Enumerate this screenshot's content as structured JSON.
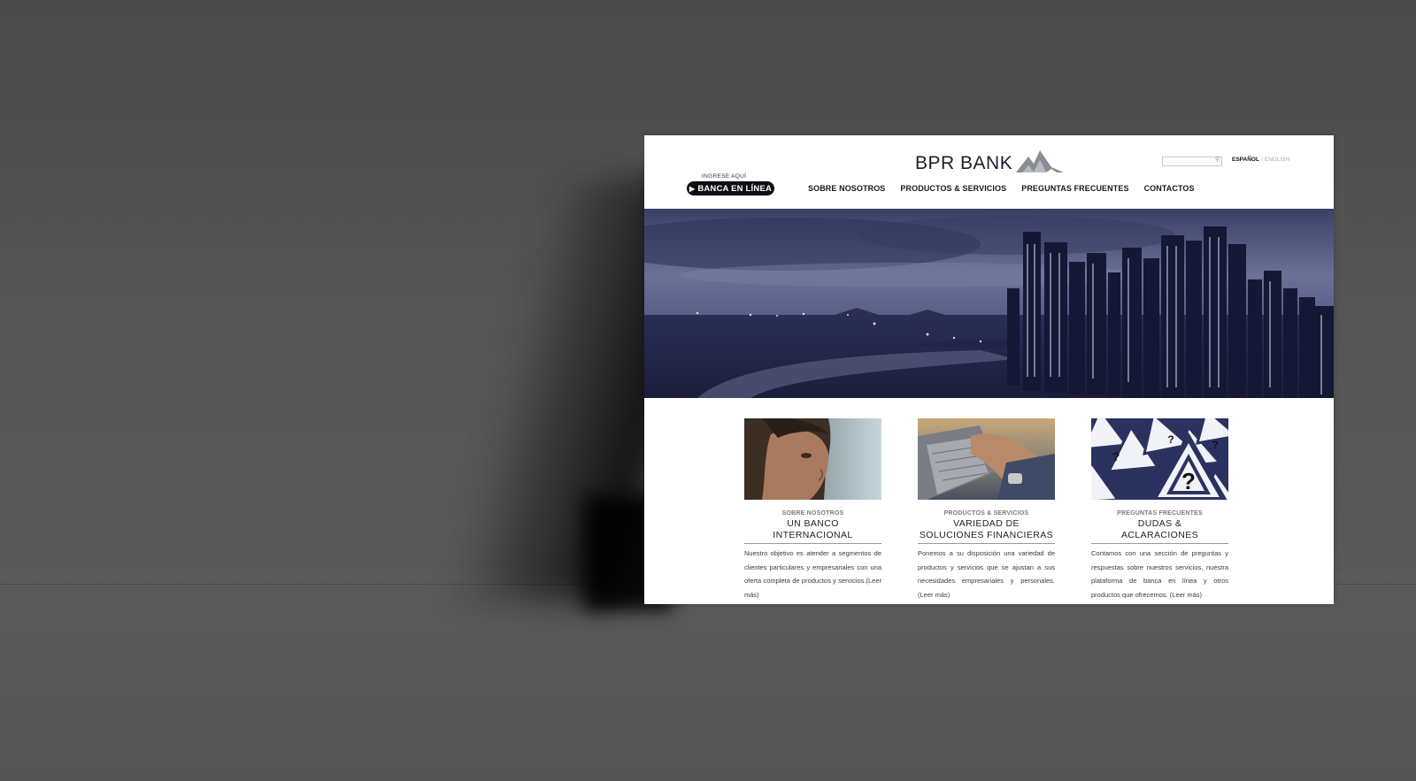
{
  "site": {
    "brand": "BPR BANK",
    "search": {
      "placeholder": ""
    },
    "lang": {
      "active": "ESPAÑOL",
      "separator": "/",
      "inactive": "ENGLISH"
    },
    "login": {
      "eyebrow": "INGRESE AQUÍ",
      "label": "BANCA EN LÍNEA"
    },
    "nav": [
      {
        "label": "SOBRE NOSOTROS"
      },
      {
        "label": "PRODUCTOS  & SERVICIOS"
      },
      {
        "label": "PREGUNTAS FRECUENTES"
      },
      {
        "label": "CONTACTOS"
      }
    ],
    "cards": [
      {
        "eyebrow": "SOBRE NOSOTROS",
        "title_line1": "UN BANCO",
        "title_line2": "INTERNACIONAL",
        "body": "Nuestro objetivo es atender a segmentos de clientes particulares y empresariales con una oferta completa de productos y servicios.(Leer más)"
      },
      {
        "eyebrow": "PRODUCTOS & SERVICIOS",
        "title_line1": "VARIEDAD DE",
        "title_line2": "SOLUCIONES FINANCIERAS",
        "body": "Ponemos a su disposición una variedad de productos y servicios que se ajustan a sus necesidades empresariales y personales. (Leer más)"
      },
      {
        "eyebrow": "PREGUNTAS FRECUENTES",
        "title_line1": "DUDAS &",
        "title_line2": "ACLARACIONES",
        "body": "Contamos con una sección de preguntas y respuestas sobre nuestros servicios, nuestra plataforma de banca en línea y otros productos que ofrecemos. (Leer más)"
      }
    ]
  },
  "icons": {
    "logo": "mountain-logo-icon",
    "search": "search-icon",
    "play": "play-icon"
  },
  "colors": {
    "brand_navy": "#2b2f55",
    "hero_tint": "#3a4070",
    "button_bg": "#0d0d14",
    "background": "#565656"
  }
}
